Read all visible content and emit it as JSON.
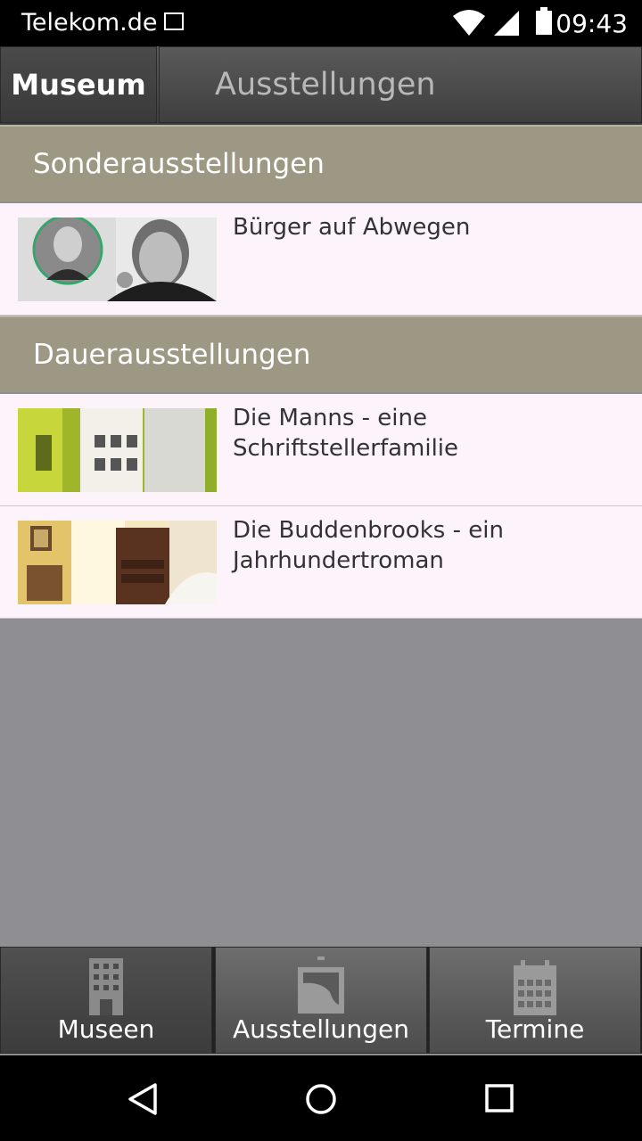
{
  "status_bar": {
    "carrier": "Telekom.de",
    "time": "09:43"
  },
  "tabs": [
    {
      "label": "Museum",
      "active": true
    },
    {
      "label": "Ausstellungen",
      "active": false
    }
  ],
  "sections": [
    {
      "title": "Sonderausstellungen",
      "items": [
        {
          "title": "Bürger auf Abwegen"
        }
      ]
    },
    {
      "title": "Dauerausstellungen",
      "items": [
        {
          "title": "Die Manns - eine Schriftstellerfamilie"
        },
        {
          "title": "Die Buddenbrooks - ein Jahrhundertroman"
        }
      ]
    }
  ],
  "bottom_nav": [
    {
      "label": "Museen",
      "icon": "building-icon",
      "active": true
    },
    {
      "label": "Ausstellungen",
      "icon": "picture-icon",
      "active": false
    },
    {
      "label": "Termine",
      "icon": "calendar-icon",
      "active": false
    }
  ],
  "system_nav": {
    "back": "back-icon",
    "home": "home-icon",
    "recents": "recents-icon"
  }
}
